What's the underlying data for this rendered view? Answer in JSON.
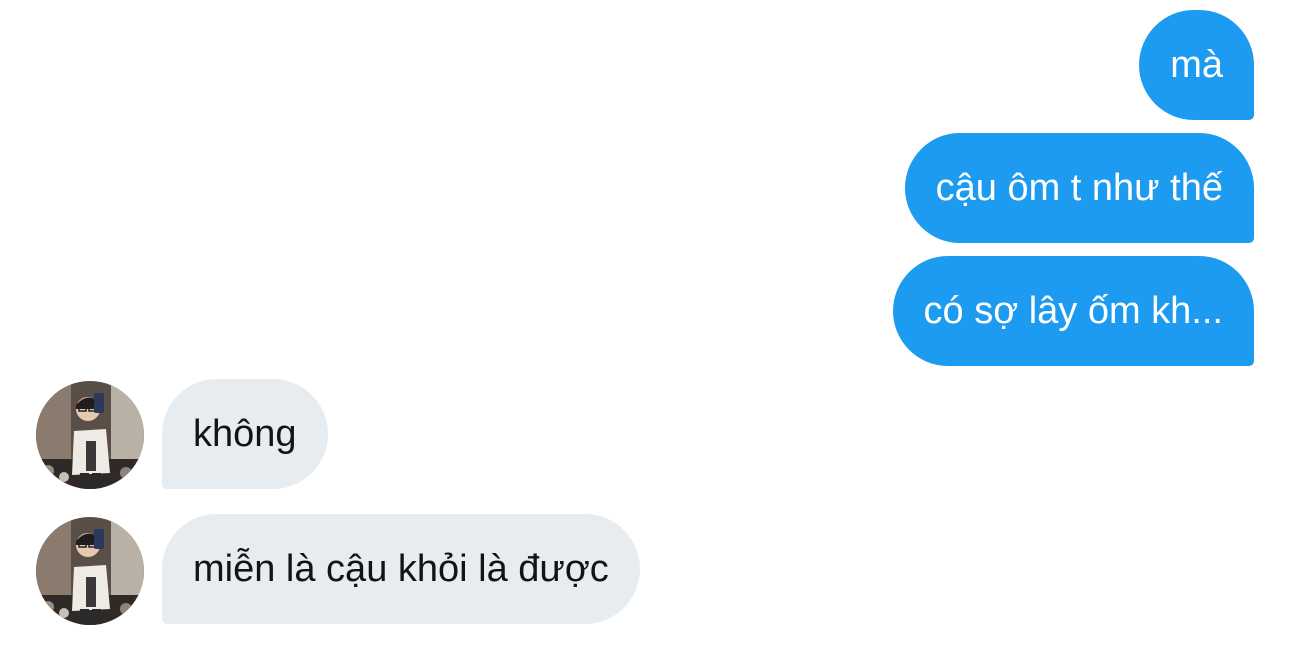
{
  "conversation": {
    "sent_messages": [
      {
        "text": "mà"
      },
      {
        "text": "cậu ôm t như thế"
      },
      {
        "text": "có sợ lây ốm kh..."
      }
    ],
    "received_messages": [
      {
        "text": "không",
        "avatar_icon": "user-avatar-icon"
      },
      {
        "text": "miễn là cậu khỏi là được",
        "avatar_icon": "user-avatar-icon"
      }
    ]
  },
  "colors": {
    "sent_bubble": "#1d9bf0",
    "sent_text": "#ffffff",
    "received_bubble": "#e7ecf0",
    "received_text": "#0f1419",
    "background": "#ffffff"
  }
}
